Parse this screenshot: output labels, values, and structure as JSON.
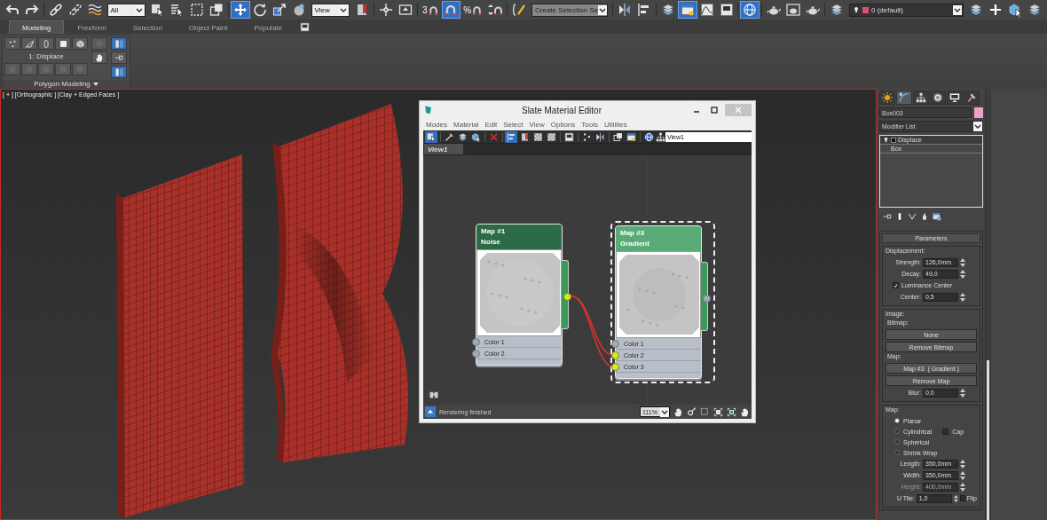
{
  "toolbar": {
    "items": [
      {
        "kind": "undo",
        "selected": false
      },
      {
        "kind": "redo",
        "selected": false
      },
      {
        "kind": "divider"
      },
      {
        "kind": "link",
        "selected": false
      },
      {
        "kind": "unlink",
        "selected": false
      },
      {
        "kind": "bind",
        "selected": false
      },
      {
        "kind": "dropdown",
        "value": "All"
      },
      {
        "kind": "select",
        "selected": false
      },
      {
        "kind": "select-list",
        "selected": false
      },
      {
        "kind": "rect-select",
        "selected": false
      },
      {
        "kind": "crossing",
        "selected": false
      },
      {
        "kind": "divider"
      },
      {
        "kind": "move",
        "selected": true
      },
      {
        "kind": "rotate",
        "selected": false
      },
      {
        "kind": "scale",
        "selected": false
      },
      {
        "kind": "sphere",
        "selected": false
      },
      {
        "kind": "dropdown",
        "value": "View"
      },
      {
        "kind": "flag",
        "selected": false
      },
      {
        "kind": "divider"
      },
      {
        "kind": "cross",
        "selected": false
      },
      {
        "kind": "keybox",
        "selected": false
      },
      {
        "kind": "divider"
      },
      {
        "kind": "snap",
        "label": "3",
        "selected": false
      },
      {
        "kind": "magnet",
        "selected": true
      },
      {
        "kind": "snap",
        "label": "%",
        "selected": false
      },
      {
        "kind": "spinner",
        "selected": false
      },
      {
        "kind": "divider"
      },
      {
        "kind": "edit",
        "selected": false
      },
      {
        "kind": "dropdown-grey",
        "value": "Create Selection Se"
      },
      {
        "kind": "divider"
      },
      {
        "kind": "mirror",
        "selected": false
      },
      {
        "kind": "align",
        "selected": false
      },
      {
        "kind": "divider"
      },
      {
        "kind": "layers",
        "selected": false
      },
      {
        "kind": "window",
        "selected": true
      },
      {
        "kind": "curve",
        "selected": false
      },
      {
        "kind": "schematic",
        "selected": false
      },
      {
        "kind": "divider"
      },
      {
        "kind": "globe",
        "selected": true
      },
      {
        "kind": "divider"
      },
      {
        "kind": "teapot",
        "selected": false
      },
      {
        "kind": "frame",
        "selected": false
      },
      {
        "kind": "teapot",
        "selected": false
      },
      {
        "kind": "divider"
      },
      {
        "kind": "layers",
        "selected": false
      },
      {
        "kind": "layer-dropdown",
        "value": "0 (default)"
      },
      {
        "kind": "layers",
        "selected": false
      },
      {
        "kind": "plus",
        "selected": false
      },
      {
        "kind": "box-cursor",
        "selected": false
      },
      {
        "kind": "layers",
        "selected": false
      }
    ]
  },
  "ribbon": {
    "tabs": [
      {
        "label": "Modeling",
        "selected": true
      },
      {
        "label": "Freeform",
        "selected": false
      },
      {
        "label": "Selection",
        "selected": false
      },
      {
        "label": "Object Paint",
        "selected": false
      },
      {
        "label": "Populate",
        "selected": false
      }
    ],
    "panel": {
      "title": "1: Displace",
      "footer": "Polygon Modeling"
    }
  },
  "viewport": {
    "label": "[ + ] [Orthographic ] [Clay + Edged Faces ]"
  },
  "slate_editor": {
    "title": "Slate Material Editor",
    "menu": [
      "Modes",
      "Material",
      "Edit",
      "Select",
      "View",
      "Options",
      "Tools",
      "Utilities"
    ],
    "toolbar": [
      {
        "kind": "select",
        "selected": true
      },
      {
        "kind": "divider"
      },
      {
        "kind": "eyedropper",
        "selected": false
      },
      {
        "kind": "layers",
        "selected": false
      },
      {
        "kind": "box-cursor",
        "selected": false
      },
      {
        "kind": "divider"
      },
      {
        "kind": "delete",
        "selected": false
      },
      {
        "kind": "divider"
      },
      {
        "kind": "align",
        "selected": true
      },
      {
        "kind": "flag",
        "selected": false
      },
      {
        "kind": "checker",
        "selected": false
      },
      {
        "kind": "checker",
        "selected": false
      },
      {
        "kind": "divider"
      },
      {
        "kind": "schematic",
        "selected": false
      },
      {
        "kind": "divider"
      },
      {
        "kind": "dots",
        "selected": false
      },
      {
        "kind": "mirror",
        "selected": false
      },
      {
        "kind": "divider"
      },
      {
        "kind": "crossing",
        "selected": false
      },
      {
        "kind": "window",
        "selected": false
      },
      {
        "kind": "divider"
      },
      {
        "kind": "globe",
        "selected": false
      }
    ],
    "view_field": "View1",
    "tab": "View1",
    "nodes": [
      {
        "title": "Map #1",
        "type": "Noise",
        "selected": false,
        "output_connected": true,
        "slots": [
          {
            "label": "Color 1",
            "connected": false
          },
          {
            "label": "Color 2",
            "connected": false
          }
        ]
      },
      {
        "title": "Map #3",
        "type": "Gradient",
        "selected": true,
        "output_connected": false,
        "slots": [
          {
            "label": "Color 1",
            "connected": false
          },
          {
            "label": "Color 2",
            "connected": true
          },
          {
            "label": "Color 3",
            "connected": true
          }
        ]
      }
    ],
    "status": "Rendering finished",
    "zoom": "111%"
  },
  "command_panel": {
    "tabs": [
      {
        "kind": "sun",
        "selected": false
      },
      {
        "kind": "curvetool",
        "selected": true
      },
      {
        "kind": "hierarchy",
        "selected": false
      },
      {
        "kind": "disc",
        "selected": false
      },
      {
        "kind": "monitor",
        "selected": false
      },
      {
        "kind": "hammer",
        "selected": false
      }
    ],
    "object_name": "Box003",
    "modifier_list": "Modifier List",
    "stack": [
      {
        "kind": "modifier",
        "label": "Displace"
      },
      {
        "kind": "base",
        "label": "Box"
      }
    ],
    "rollout": {
      "title": "Parameters",
      "groups": [
        {
          "title": "Displacement:",
          "items": [
            {
              "kind": "spinner",
              "label": "Strength:",
              "value": "126,0mm",
              "disabled": false
            },
            {
              "kind": "spinner",
              "label": "Decay:",
              "value": "49,0",
              "disabled": false
            },
            {
              "kind": "checkbox",
              "label": "Luminance Center",
              "checked": true
            },
            {
              "kind": "spinner",
              "label": "Center:",
              "value": "0,5",
              "disabled": false
            }
          ]
        },
        {
          "title": "Image:",
          "items": [
            {
              "kind": "caption",
              "label": "Bitmap:"
            },
            {
              "kind": "button",
              "label": "None"
            },
            {
              "kind": "button",
              "label": "Remove Bitmap"
            },
            {
              "kind": "caption",
              "label": "Map:"
            },
            {
              "kind": "button",
              "label": "Map #3  ( Gradient )"
            },
            {
              "kind": "button",
              "label": "Remove Map"
            },
            {
              "kind": "spinner",
              "label": "Blur:",
              "value": "0,0",
              "disabled": false
            }
          ]
        },
        {
          "title": "Map:",
          "items": [
            {
              "kind": "radio",
              "label": "Planar",
              "selected": true
            },
            {
              "kind": "radio",
              "label": "Cylindrical",
              "selected": false,
              "option": {
                "label": "Cap",
                "checked": false
              }
            },
            {
              "kind": "radio",
              "label": "Spherical",
              "selected": false
            },
            {
              "kind": "radio",
              "label": "Shrink Wrap",
              "selected": false
            },
            {
              "kind": "spinner",
              "label": "Length:",
              "value": "350,0mm",
              "disabled": false
            },
            {
              "kind": "spinner",
              "label": "Width:",
              "value": "350,0mm",
              "disabled": false
            },
            {
              "kind": "spinner",
              "label": "Height:",
              "value": "400,0mm",
              "disabled": true
            },
            {
              "kind": "spinner",
              "label": "U Tile:",
              "value": "1,0",
              "disabled": false,
              "option": {
                "label": "Flip",
                "checked": false
              }
            }
          ]
        }
      ]
    }
  }
}
